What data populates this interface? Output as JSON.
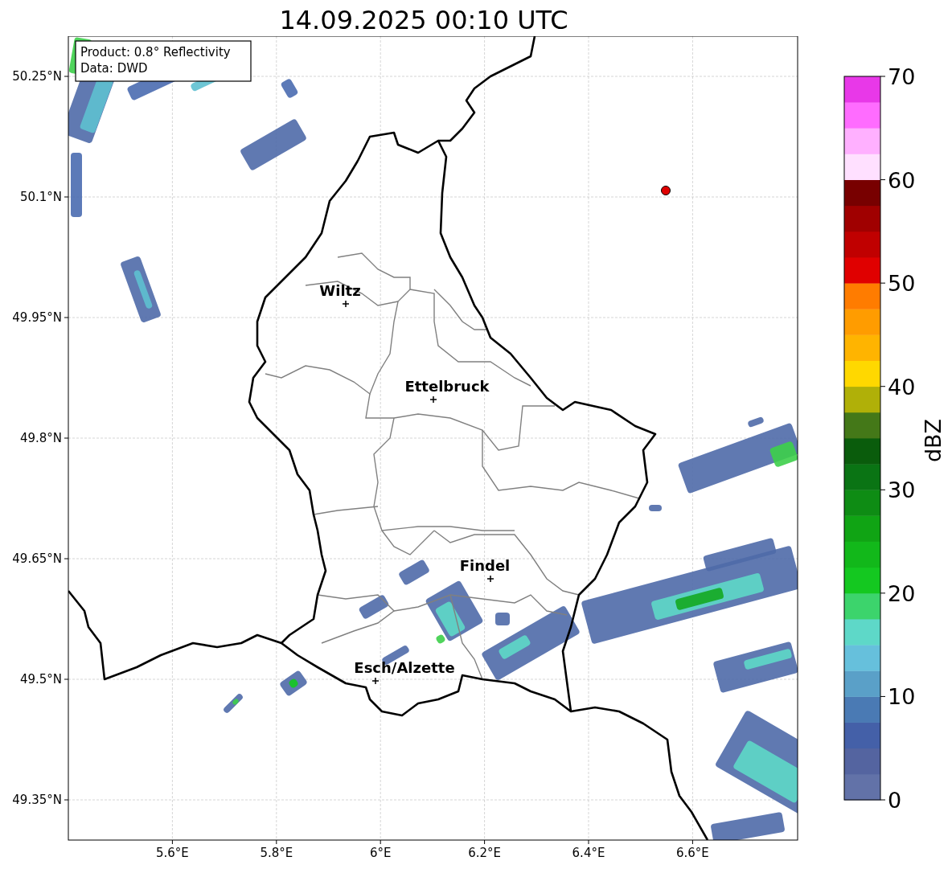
{
  "title": "14.09.2025 00:10 UTC",
  "info_box": [
    "Product: 0.8° Reflectivity",
    "Data: DWD"
  ],
  "lat_ticks": [
    "50.25°N",
    "50.1°N",
    "49.95°N",
    "49.8°N",
    "49.65°N",
    "49.5°N",
    "49.35°N"
  ],
  "lon_ticks": [
    "5.6°E",
    "5.8°E",
    "6°E",
    "6.2°E",
    "6.4°E",
    "6.6°E"
  ],
  "cities": [
    {
      "name": "Wiltz"
    },
    {
      "name": "Ettelbruck"
    },
    {
      "name": "Findel"
    },
    {
      "name": "Esch/Alzette"
    }
  ],
  "colorbar": {
    "label": "dBZ",
    "ticks": [
      "70",
      "60",
      "50",
      "40",
      "30",
      "20",
      "10",
      "0"
    ],
    "bins": [
      {
        "color": "#6272a8"
      },
      {
        "color": "#5464a0"
      },
      {
        "color": "#4460a8"
      },
      {
        "color": "#4a7ab4"
      },
      {
        "color": "#5aa0c8"
      },
      {
        "color": "#66c0dc"
      },
      {
        "color": "#5ed8c8"
      },
      {
        "color": "#3cd46c"
      },
      {
        "color": "#14c820"
      },
      {
        "color": "#12b81a"
      },
      {
        "color": "#10a414"
      },
      {
        "color": "#0e8c14"
      },
      {
        "color": "#0a7414"
      },
      {
        "color": "#0a5c0c"
      },
      {
        "color": "#447818"
      },
      {
        "color": "#b0b008"
      },
      {
        "color": "#ffd800"
      },
      {
        "color": "#ffb400"
      },
      {
        "color": "#ff9c00"
      },
      {
        "color": "#ff7c00"
      },
      {
        "color": "#e00000"
      },
      {
        "color": "#c00000"
      },
      {
        "color": "#a00000"
      },
      {
        "color": "#780000"
      },
      {
        "color": "#ffe0ff"
      },
      {
        "color": "#ffb0ff"
      },
      {
        "color": "#ff6cff"
      },
      {
        "color": "#e838e8"
      }
    ]
  }
}
